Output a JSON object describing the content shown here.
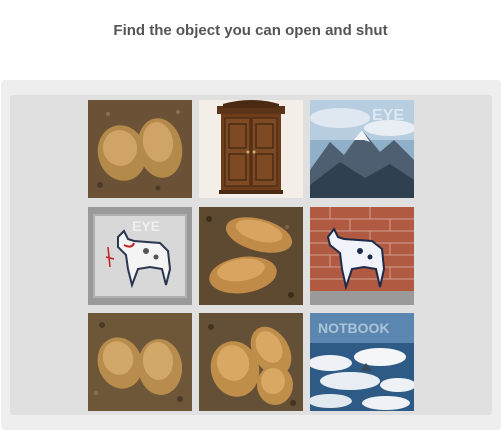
{
  "challenge": {
    "prompt": "Find the object you can open and shut"
  },
  "grid": {
    "tiles": [
      {
        "subject": "potatoes on soil"
      },
      {
        "subject": "wooden wardrobe"
      },
      {
        "subject": "mountain range",
        "watermark": "EYE"
      },
      {
        "subject": "dog graffiti on stone wall",
        "watermark": "EYE"
      },
      {
        "subject": "potatoes on soil"
      },
      {
        "subject": "dog graffiti on brick wall"
      },
      {
        "subject": "potatoes on soil"
      },
      {
        "subject": "potatoes on soil"
      },
      {
        "subject": "mountains above clouds",
        "watermark": "NOTBOOK"
      }
    ]
  },
  "colors": {
    "prompt_text": "#555555",
    "outer_panel": "#eeeeee",
    "inner_panel": "#e0e0e0"
  }
}
